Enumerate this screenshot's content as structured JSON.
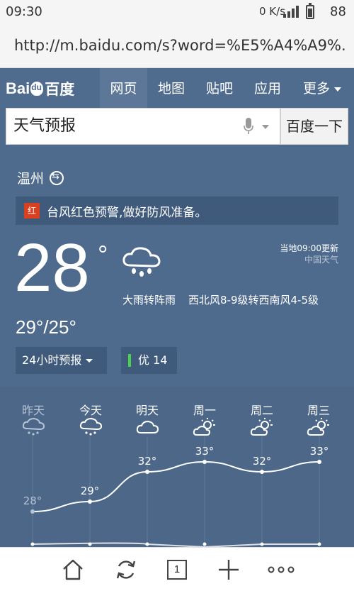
{
  "status_bar": {
    "time": "09:30",
    "network": "0 K/s",
    "battery": "88"
  },
  "browser": {
    "url": "http://m.baidu.com/s?word=%E5%A4%A9%.."
  },
  "header": {
    "logo_text": "Bai",
    "logo_cn": "百度",
    "tabs": [
      {
        "label": "网页",
        "active": true
      },
      {
        "label": "地图"
      },
      {
        "label": "贴吧"
      },
      {
        "label": "应用"
      },
      {
        "label": "更多"
      }
    ]
  },
  "search": {
    "value": "天气预报",
    "button": "百度一下"
  },
  "weather": {
    "city": "温州",
    "alert_badge": "红",
    "alert_text": "台风红色预警,做好防风准备。",
    "temperature": "28",
    "degree": "°",
    "condition": "大雨转阵雨",
    "wind": "西北风8-9级转西南风4-5级",
    "update_time": "当地09:00更新",
    "source": "中国天气",
    "range": "29°/25°",
    "forecast_button": "24小时预报",
    "aqi": "优 14"
  },
  "forecast": {
    "days": [
      {
        "label": "昨天",
        "icon": "rain-cloud-icon",
        "high": "28°"
      },
      {
        "label": "今天",
        "icon": "rain-cloud-icon",
        "high": "29°"
      },
      {
        "label": "明天",
        "icon": "cloud-icon",
        "high": "32°"
      },
      {
        "label": "周一",
        "icon": "sun-cloud-icon",
        "high": "33°"
      },
      {
        "label": "周二",
        "icon": "sun-cloud-icon",
        "high": "32°"
      },
      {
        "label": "周三",
        "icon": "sun-cloud-icon",
        "high": "33°"
      }
    ]
  },
  "chart_data": {
    "type": "line",
    "categories": [
      "昨天",
      "今天",
      "明天",
      "周一",
      "周二",
      "周三"
    ],
    "series": [
      {
        "values": [
          28,
          29,
          32,
          33,
          32,
          33
        ]
      }
    ]
  },
  "bottom_bar": {
    "tab_count": "1"
  },
  "colors": {
    "background": "#4e6a8c",
    "alert_badge": "#d9401f",
    "aqi_bar": "#4ad04a"
  }
}
